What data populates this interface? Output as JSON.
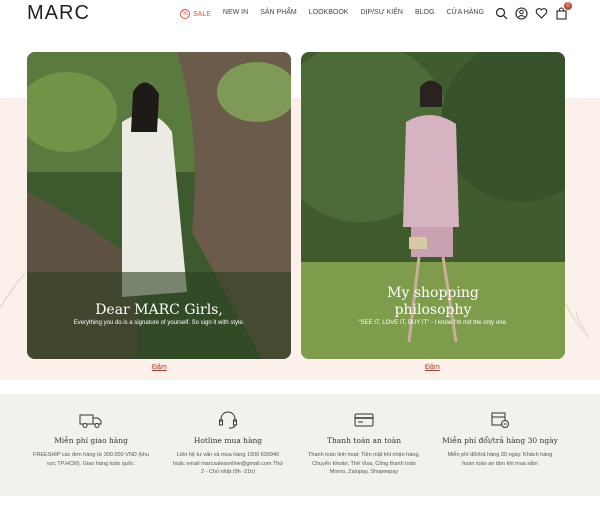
{
  "header": {
    "logo": "MARC",
    "nav": [
      {
        "label": "SALE"
      },
      {
        "label": "NEW IN"
      },
      {
        "label": "SẢN PHẨM"
      },
      {
        "label": "LOOKBOOK"
      },
      {
        "label": "DỊP/SỰ KIỆN"
      },
      {
        "label": "BLOG"
      },
      {
        "label": "CỬA HÀNG"
      }
    ],
    "cart_count": "0",
    "icons": [
      "search-icon",
      "user-icon",
      "heart-icon",
      "cart-icon"
    ]
  },
  "cards": [
    {
      "title": "Dear MARC Girls,",
      "subtitle": "Everything you do is a signature of yourself. So sign it with style.",
      "link": "Đậm"
    },
    {
      "title_line1": "My shopping",
      "title_line2": "philosophy",
      "subtitle": "\"SEE IT, LOVE IT, BUY IT\" - I know I'm not the only one.",
      "link": "Đậm"
    }
  ],
  "features": [
    {
      "icon": "truck-icon",
      "title": "Miễn phí giao hàng",
      "desc_line1": "FREESHIP các đơn hàng từ 300.000 VND (khu",
      "desc_line2": "vực TP.HCM). Giao hàng toàn quốc."
    },
    {
      "icon": "headset-icon",
      "title": "Hotline mua hàng",
      "desc_line1": "Liên hệ tư vấn và mua hàng 1900 636940",
      "desc_line2": "hoặc email marcsalesonline@gmail.com Thứ",
      "desc_line3": "2 - Chủ nhật (9h -21h)"
    },
    {
      "icon": "card-icon",
      "title": "Thanh toán an toàn",
      "desc_line1": "Thanh toán linh hoạt: Tiền mặt khi nhận hàng,",
      "desc_line2": "Chuyển khoản, Thẻ Visa, Cổng thanh toán",
      "desc_line3": "Momo, Zalopay, Shopeepay"
    },
    {
      "icon": "return-icon",
      "title": "Miễn phí đổi/trả hàng 30 ngày",
      "desc_line1": "Miễn phí đổi/trả hàng 30 ngày. Khách hàng",
      "desc_line2": "hoàn toàn an tâm khi mua sắm"
    }
  ],
  "colors": {
    "sale": "#e0513f",
    "hero_bg": "#fbf0ea",
    "features_bg": "#f2f2ec",
    "link": "#a23c2c"
  }
}
